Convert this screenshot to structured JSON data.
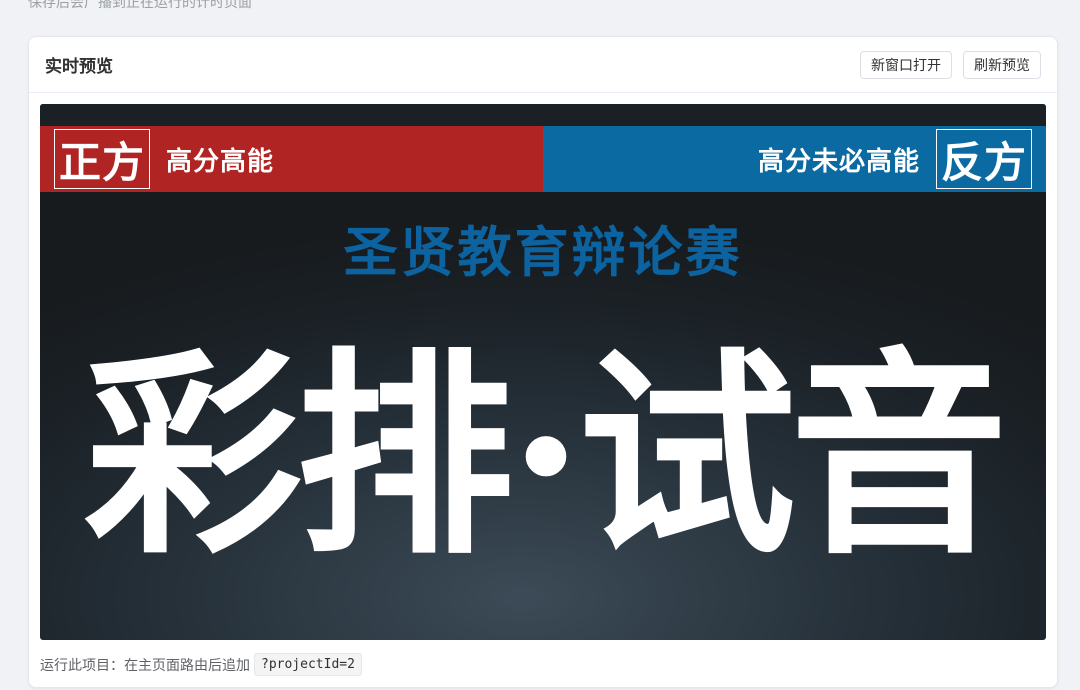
{
  "top_hint": "保存后会广播到正在运行的计时页面",
  "card": {
    "title": "实时预览",
    "open_new_window_label": "新窗口打开",
    "refresh_label": "刷新预览"
  },
  "preview": {
    "pro_label": "正方",
    "pro_stance": "高分高能",
    "con_label": "反方",
    "con_stance": "高分未必高能",
    "event_name": "圣贤教育辩论赛",
    "main_text": "彩排·试音",
    "colors": {
      "pro": "#b12424",
      "con": "#0b6aa2",
      "event_name": "#0c63a0"
    }
  },
  "footer": {
    "hint": "运行此项目：在主页面路由后追加",
    "code": "?projectId=2"
  }
}
